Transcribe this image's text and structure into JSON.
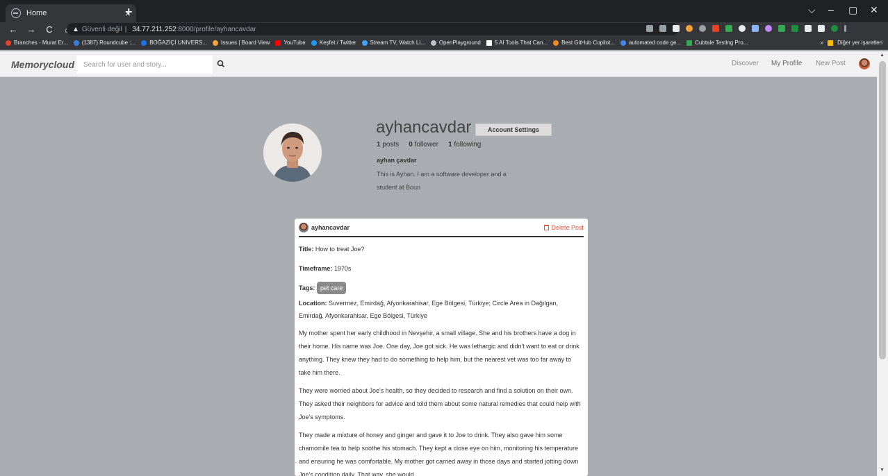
{
  "browser": {
    "tab_title": "Home",
    "tab_close": "×",
    "new_tab": "+",
    "window_controls": [
      "⌵",
      "–",
      "▢",
      "✕"
    ],
    "nav": [
      "←",
      "→",
      "C",
      "⌂"
    ],
    "security_label": "Güvenli değil",
    "url_host": "34.77.211.252",
    "url_path": ":8000/profile/ayhancavdar",
    "bookmarks": [
      {
        "label": "Branches - Murat Er...",
        "color": "#e24329"
      },
      {
        "label": "(1387) Roundcube :...",
        "color": "#3b7ddd"
      },
      {
        "label": "BOĞAZİÇİ UNIVERS...",
        "color": "#1a73e8"
      },
      {
        "label": "Issues | Board View",
        "color": "#f4a23a"
      },
      {
        "label": "YouTube",
        "color": "#ff0000"
      },
      {
        "label": "Keşfet / Twitter",
        "color": "#1d9bf0"
      },
      {
        "label": "Stream TV, Watch Li...",
        "color": "#3ea6ff"
      },
      {
        "label": "OpenPlayground",
        "color": "#bdc1c6"
      },
      {
        "label": "5 AI Tools That Can...",
        "color": "#ffffff"
      },
      {
        "label": "Best GitHub Copilot...",
        "color": "#f28b22"
      },
      {
        "label": "automated code ge...",
        "color": "#4285f4"
      },
      {
        "label": "Cubtale Testing Pro...",
        "color": "#34a853"
      }
    ],
    "bookmarks_more": "»",
    "other_bookmarks": "Diğer yer işaretleri"
  },
  "app": {
    "brand": "Memorycloud",
    "search_placeholder": "Search for user and story...",
    "nav_discover": "Discover",
    "nav_profile": "My Profile",
    "nav_new_post": "New Post"
  },
  "profile": {
    "username": "ayhancavdar",
    "settings_label": "Account Settings",
    "posts_count": "1",
    "posts_label": "posts",
    "followers_count": "0",
    "followers_label": "follower",
    "following_count": "1",
    "following_label": "following",
    "full_name": "ayhan çavdar",
    "bio": "This is Ayhan. I am a software developer and a student at Boun"
  },
  "post": {
    "author": "ayhancavdar",
    "delete_label": "Delete Post",
    "title_key": "Title:",
    "title": "How to treat Joe?",
    "timeframe_key": "Timeframe:",
    "timeframe": "1970s",
    "tags_key": "Tags:",
    "tags": [
      "pet care"
    ],
    "location_key": "Location:",
    "location": "Suvermez, Emirdağ, Afyonkarahisar, Ege Bölgesi, Türkiye; Circle Area in Dağılgan, Emirdağ, Afyonkarahisar, Ege Bölgesi, Türkiye",
    "paragraphs": [
      "My mother spent her early childhood in Nevşehir, a small village. She and his brothers have a dog in their home. His name was Joe. One day, Joe got sick. He was lethargic and didn't want to eat or drink anything. They knew they had to do something to help him, but the nearest vet was too far away to take him there.",
      "They were worried about Joe's health, so they decided to research and find a solution on their own. They asked their neighbors for advice and told them about some natural remedies that could help with Joe's symptoms.",
      "They made a mixture of honey and ginger and gave it to Joe to drink. They also gave him some chamomile tea to help soothe his stomach. They kept a close eye on him, monitoring his temperature and ensuring he was comfortable. My mother got carried away in those days and started jotting down Joe's condition daily. That way, she would"
    ]
  }
}
